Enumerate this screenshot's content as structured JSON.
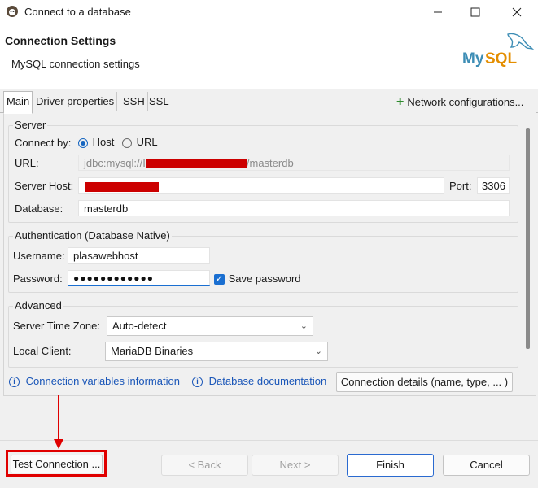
{
  "window": {
    "title": "Connect to a database",
    "controls": [
      "minimize",
      "maximize",
      "close"
    ]
  },
  "header": {
    "title": "Connection Settings",
    "subtitle": "MySQL connection settings",
    "logo_text": "MySQL"
  },
  "tabs": [
    {
      "label": "Main",
      "active": true
    },
    {
      "label": "Driver properties",
      "active": false
    },
    {
      "label": "SSH",
      "active": false
    },
    {
      "label": "SSL",
      "active": false
    }
  ],
  "network_config": "Network configurations...",
  "server": {
    "group_label": "Server",
    "connect_by_label": "Connect by:",
    "option_host": "Host",
    "option_url": "URL",
    "selected": "Host",
    "url_label": "URL:",
    "url_prefix": "jdbc:mysql://",
    "url_visible_char": "I",
    "url_suffix": "/masterdb",
    "host_label": "Server Host:",
    "port_label": "Port:",
    "port_value": "3306",
    "database_label": "Database:",
    "database_value": "masterdb"
  },
  "auth": {
    "group_label": "Authentication (Database Native)",
    "username_label": "Username:",
    "username_value": "plasawebhost",
    "password_label": "Password:",
    "password_value": "●●●●●●●●●●●●",
    "save_password_label": "Save password",
    "save_password_checked": true
  },
  "advanced": {
    "group_label": "Advanced",
    "timezone_label": "Server Time Zone:",
    "timezone_value": "Auto-detect",
    "client_label": "Local Client:",
    "client_value": "MariaDB Binaries"
  },
  "links": {
    "conn_vars": "Connection variables information",
    "db_docs": "Database documentation",
    "conn_details": "Connection details (name, type, ... )"
  },
  "buttons": {
    "test": "Test Connection ...",
    "back": "< Back",
    "next": "Next >",
    "finish": "Finish",
    "cancel": "Cancel"
  },
  "colors": {
    "annotation_red": "#e00000",
    "accent_blue": "#1a6fd1",
    "link_blue": "#1a56b8",
    "plus_green": "#2e8b2e",
    "redaction": "#cc0000"
  }
}
